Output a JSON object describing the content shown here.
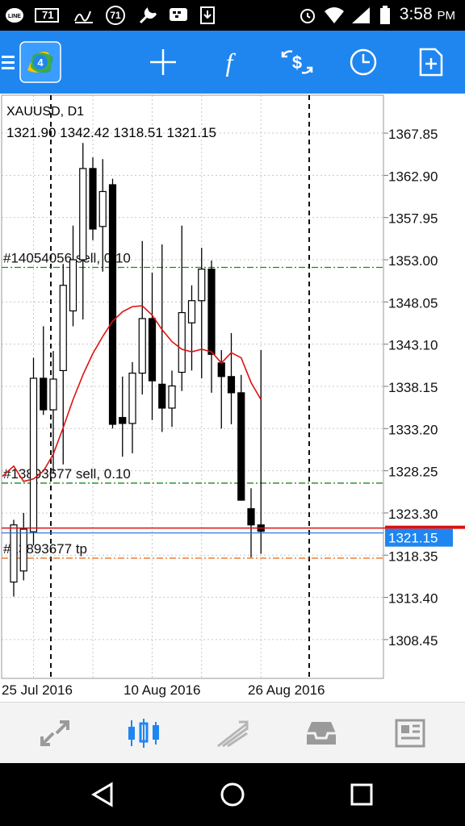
{
  "status_bar": {
    "time": "3:58",
    "ampm": "PM",
    "notif_badge_1": "71",
    "notif_badge_2": "71",
    "icons": [
      "line-app-icon",
      "notification-71-icon",
      "signature-icon",
      "badge-71-icon",
      "wrench-icon",
      "bbm-icon",
      "download-icon",
      "alarm-icon",
      "wifi-icon",
      "signal-icon",
      "battery-icon"
    ]
  },
  "toolbar": {
    "icons": [
      "menu-icon",
      "metatrader-logo-icon",
      "crosshair-icon",
      "function-icon",
      "trade-icon",
      "clock-icon",
      "add-document-icon"
    ],
    "function_glyph": "f"
  },
  "chart": {
    "symbol": "XAUUSD, D1",
    "ohlc": "1321.90 1342.42 1318.51 1321.15",
    "current_price": "1321.15",
    "colors": {
      "ma": "#e01010",
      "bid_line": "#e01010",
      "ask_line": "#1a6fd0",
      "order_line": "#1a8a1a",
      "tp_line": "#f07020",
      "price_badge": "#1f86f0"
    },
    "orders": [
      {
        "label": "#14054056 sell, 0.10",
        "price": 1352.1,
        "kind": "sell"
      },
      {
        "label": "#13893677 sell, 0.10",
        "price": 1326.8,
        "kind": "sell"
      },
      {
        "label": "#13893677 tp",
        "price": 1318.0,
        "kind": "tp"
      }
    ],
    "separator_dates": [
      "25 Jul 2016",
      "26 Aug 2016"
    ]
  },
  "chart_data": {
    "type": "candlestick",
    "title": "XAUUSD, D1",
    "y_ticks": [
      "1367.85",
      "1362.90",
      "1357.95",
      "1353.00",
      "1348.05",
      "1343.10",
      "1338.15",
      "1333.20",
      "1328.25",
      "1323.30",
      "1318.35",
      "1313.40",
      "1308.45"
    ],
    "x_labels": [
      "25 Jul 2016",
      "10 Aug 2016",
      "26 Aug 2016"
    ],
    "ylim": [
      1303.9,
      1372.3
    ],
    "candles": [
      {
        "o": 1315.2,
        "h": 1322.5,
        "l": 1313.5,
        "c": 1321.9
      },
      {
        "o": 1316.5,
        "h": 1323.3,
        "l": 1315.4,
        "c": 1321.4
      },
      {
        "o": 1321.1,
        "h": 1341.5,
        "l": 1319.5,
        "c": 1339.1
      },
      {
        "o": 1339.1,
        "h": 1345.2,
        "l": 1334.8,
        "c": 1335.4
      },
      {
        "o": 1335.4,
        "h": 1342.3,
        "l": 1327.9,
        "c": 1339.0
      },
      {
        "o": 1340.0,
        "h": 1352.5,
        "l": 1329.0,
        "c": 1350.0
      },
      {
        "o": 1347.0,
        "h": 1357.0,
        "l": 1345.2,
        "c": 1353.0
      },
      {
        "o": 1353.0,
        "h": 1366.7,
        "l": 1346.0,
        "c": 1363.7
      },
      {
        "o": 1363.7,
        "h": 1365.0,
        "l": 1355.3,
        "c": 1356.6
      },
      {
        "o": 1356.9,
        "h": 1364.8,
        "l": 1351.6,
        "c": 1361.0
      },
      {
        "o": 1361.8,
        "h": 1362.5,
        "l": 1333.2,
        "c": 1333.7
      },
      {
        "o": 1334.5,
        "h": 1339.3,
        "l": 1329.9,
        "c": 1333.8
      },
      {
        "o": 1333.8,
        "h": 1341.0,
        "l": 1330.3,
        "c": 1339.7
      },
      {
        "o": 1339.7,
        "h": 1355.2,
        "l": 1337.2,
        "c": 1346.1
      },
      {
        "o": 1346.1,
        "h": 1351.5,
        "l": 1334.2,
        "c": 1338.8
      },
      {
        "o": 1338.4,
        "h": 1354.8,
        "l": 1332.8,
        "c": 1335.6
      },
      {
        "o": 1335.6,
        "h": 1340.0,
        "l": 1333.4,
        "c": 1338.2
      },
      {
        "o": 1339.8,
        "h": 1357.0,
        "l": 1337.6,
        "c": 1346.8
      },
      {
        "o": 1345.6,
        "h": 1350.0,
        "l": 1340.0,
        "c": 1348.2
      },
      {
        "o": 1348.2,
        "h": 1354.4,
        "l": 1339.1,
        "c": 1351.9
      },
      {
        "o": 1351.9,
        "h": 1352.9,
        "l": 1337.4,
        "c": 1341.9
      },
      {
        "o": 1340.9,
        "h": 1342.4,
        "l": 1333.2,
        "c": 1339.3
      },
      {
        "o": 1339.3,
        "h": 1344.4,
        "l": 1333.7,
        "c": 1337.4
      },
      {
        "o": 1337.4,
        "h": 1339.5,
        "l": 1326.3,
        "c": 1324.8
      },
      {
        "o": 1323.8,
        "h": 1326.2,
        "l": 1318.1,
        "c": 1321.9
      },
      {
        "o": 1321.9,
        "h": 1342.4,
        "l": 1318.5,
        "c": 1321.15
      }
    ],
    "moving_average": [
      1328.8,
      1327.0,
      1327.3,
      1328.2,
      1330.2,
      1333.3,
      1336.6,
      1339.5,
      1342.0,
      1344.0,
      1345.8,
      1346.9,
      1347.5,
      1347.6,
      1346.5,
      1344.8,
      1343.4,
      1342.5,
      1342.2,
      1342.5,
      1342.2,
      1340.9,
      1342.1,
      1341.5,
      1338.6,
      1336.6
    ],
    "series": [
      {
        "name": "",
        "type": "moving-average"
      }
    ],
    "grid": true
  },
  "bottom_nav": {
    "items": [
      "quotes-icon",
      "chart-candles-icon",
      "trade-icon",
      "history-inbox-icon",
      "news-icon"
    ],
    "active": "chart-candles-icon"
  },
  "system_nav": {
    "items": [
      "back-icon",
      "home-icon",
      "recents-icon"
    ]
  }
}
